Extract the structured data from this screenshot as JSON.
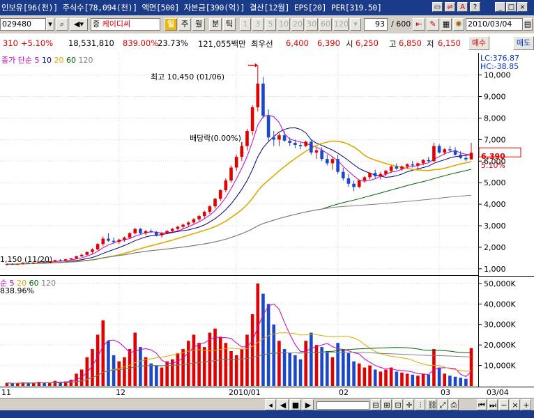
{
  "titlebar": {
    "info": "인보유[96(천)] 주식수[78,094(천)] 액면[500] 자본금[390(억)] 결산[12월] EPS[20] PER[319.50]"
  },
  "toolbar": {
    "code": "029480",
    "market_tag": "증",
    "stock_name": "케이디씨",
    "period_day": "일",
    "period_week": "주",
    "period_month": "월",
    "period_min": "분",
    "period_tick": "틱",
    "intervals": [
      "1",
      "3",
      "5",
      "10",
      "20",
      "30",
      "60",
      "120"
    ],
    "page_value": "93",
    "page_total": "/ 600",
    "date": "2010/03/04"
  },
  "quote": {
    "change": "310",
    "rate": "+5.10%",
    "volume": "18,531,810",
    "vol_rate": "839.00%",
    "turnover": "23.73%",
    "amount": "121,055백만",
    "best_label": "최우선",
    "best_ask": "6,400",
    "best_bid": "6,390",
    "open_label": "시",
    "open": "6,250",
    "high_label": "고",
    "high": "6,850",
    "low_label": "저",
    "low": "6,150",
    "buy_label": "매수",
    "sell_label": "매도"
  },
  "price_pane": {
    "legend_title": "종가 단순",
    "ma_periods": [
      "5",
      "10",
      "20",
      "60",
      "120"
    ],
    "ma_colors": [
      "#cc00cc",
      "#000080",
      "#e0a800",
      "#006600",
      "#808080"
    ],
    "max_annotation": "최고 10,450 (01/06)",
    "dividend_annotation": "배당락(0.00%)",
    "min_annotation": "1,150 (11/20)",
    "lc": "LC:376.87",
    "hc": "HC:-38.85",
    "current_price": "6,390",
    "current_rate": "5.10%"
  },
  "vol_pane": {
    "legend_title": "순",
    "ma_periods": [
      "5",
      "20",
      "60",
      "120"
    ],
    "ratio": "838.96%"
  },
  "price_axis": [
    "10,000",
    "9,000",
    "8,000",
    "7,000",
    "6,000",
    "5,000",
    "4,000",
    "3,000",
    "2,000",
    "1,000"
  ],
  "vol_axis": [
    "50,000K",
    "40,000K",
    "30,000K",
    "20,000K",
    "10,000K"
  ],
  "x_axis": [
    "11",
    "12",
    "2010/01",
    "02",
    "03",
    "03/04"
  ],
  "colors": {
    "up": "#e00000",
    "down": "#1a48c8",
    "titlebar": "#1a3a8a"
  },
  "chart_data": {
    "type": "candlestick",
    "ylim": [
      800,
      10700
    ],
    "vol_ylim": [
      0,
      52000
    ],
    "candles": [
      [
        1200,
        1250,
        1150,
        1220,
        1500
      ],
      [
        1220,
        1260,
        1180,
        1200,
        1200
      ],
      [
        1200,
        1240,
        1170,
        1230,
        1400
      ],
      [
        1230,
        1300,
        1200,
        1280,
        1800
      ],
      [
        1280,
        1320,
        1240,
        1260,
        1500
      ],
      [
        1260,
        1300,
        1220,
        1290,
        1300
      ],
      [
        1290,
        1350,
        1260,
        1330,
        2000
      ],
      [
        1330,
        1380,
        1280,
        1300,
        1600
      ],
      [
        1300,
        1360,
        1270,
        1350,
        1700
      ],
      [
        1350,
        1420,
        1320,
        1400,
        2500
      ],
      [
        1400,
        1450,
        1350,
        1380,
        1800
      ],
      [
        1380,
        1460,
        1360,
        1440,
        2200
      ],
      [
        1440,
        1500,
        1400,
        1480,
        3000
      ],
      [
        1480,
        1600,
        1450,
        1580,
        6000
      ],
      [
        1580,
        1700,
        1550,
        1650,
        8000
      ],
      [
        1650,
        1800,
        1600,
        1780,
        14000
      ],
      [
        1780,
        1950,
        1700,
        1900,
        18000
      ],
      [
        1900,
        2200,
        1850,
        2150,
        25000
      ],
      [
        2150,
        2500,
        2050,
        2400,
        32000
      ],
      [
        2400,
        2650,
        2250,
        2300,
        22000
      ],
      [
        2300,
        2450,
        2150,
        2250,
        15000
      ],
      [
        2250,
        2400,
        2150,
        2350,
        12000
      ],
      [
        2350,
        2500,
        2250,
        2450,
        14000
      ],
      [
        2450,
        2700,
        2400,
        2650,
        18000
      ],
      [
        2650,
        2900,
        2600,
        2850,
        26000
      ],
      [
        2850,
        2900,
        2600,
        2650,
        19000
      ],
      [
        2650,
        2800,
        2550,
        2750,
        14000
      ],
      [
        2750,
        2850,
        2650,
        2700,
        11000
      ],
      [
        2700,
        2750,
        2500,
        2550,
        10000
      ],
      [
        2550,
        2700,
        2450,
        2650,
        9000
      ],
      [
        2650,
        2800,
        2600,
        2750,
        12000
      ],
      [
        2750,
        2900,
        2650,
        2850,
        13000
      ],
      [
        2850,
        3000,
        2750,
        2950,
        16000
      ],
      [
        2950,
        3100,
        2850,
        3050,
        18000
      ],
      [
        3050,
        3200,
        2950,
        3150,
        22000
      ],
      [
        3150,
        3350,
        3050,
        3300,
        25000
      ],
      [
        3300,
        3500,
        3200,
        3450,
        21000
      ],
      [
        3450,
        3700,
        3350,
        3650,
        19000
      ],
      [
        3650,
        3950,
        3550,
        3900,
        26000
      ],
      [
        3900,
        4300,
        3800,
        4250,
        28000
      ],
      [
        4250,
        4700,
        4150,
        4650,
        24000
      ],
      [
        4650,
        5200,
        4550,
        5100,
        21000
      ],
      [
        5100,
        5800,
        5000,
        5700,
        17000
      ],
      [
        5700,
        6300,
        5550,
        6200,
        15000
      ],
      [
        6200,
        6800,
        6000,
        6700,
        18000
      ],
      [
        6700,
        7500,
        6500,
        7400,
        25000
      ],
      [
        7400,
        8600,
        7200,
        8500,
        35000
      ],
      [
        8500,
        10450,
        8300,
        9600,
        50000
      ],
      [
        9600,
        9900,
        8000,
        8100,
        45000
      ],
      [
        8100,
        8400,
        6900,
        7100,
        40000
      ],
      [
        7100,
        7400,
        6700,
        7000,
        30000
      ],
      [
        7000,
        7300,
        6700,
        7200,
        22000
      ],
      [
        7200,
        7400,
        6900,
        6950,
        18000
      ],
      [
        6950,
        7100,
        6700,
        6850,
        16000
      ],
      [
        6850,
        7000,
        6600,
        6750,
        15000
      ],
      [
        6750,
        6900,
        6550,
        6700,
        13000
      ],
      [
        6700,
        6950,
        6650,
        6900,
        22000
      ],
      [
        6900,
        7000,
        6300,
        6400,
        26000
      ],
      [
        6400,
        6600,
        6100,
        6500,
        20000
      ],
      [
        6500,
        6650,
        6000,
        6100,
        19000
      ],
      [
        6100,
        6300,
        5800,
        5900,
        17000
      ],
      [
        5900,
        6200,
        5600,
        6100,
        14000
      ],
      [
        6100,
        6300,
        5400,
        5500,
        21000
      ],
      [
        5500,
        5700,
        5100,
        5200,
        18000
      ],
      [
        5200,
        5400,
        4800,
        4950,
        16000
      ],
      [
        4950,
        5100,
        4600,
        4800,
        12000
      ],
      [
        4800,
        5150,
        4750,
        5100,
        11000
      ],
      [
        5100,
        5300,
        5000,
        5250,
        9000
      ],
      [
        5250,
        5500,
        5150,
        5450,
        10000
      ],
      [
        5450,
        5600,
        5200,
        5300,
        8000
      ],
      [
        5300,
        5500,
        5150,
        5400,
        7000
      ],
      [
        5400,
        5600,
        5300,
        5550,
        8000
      ],
      [
        5550,
        5800,
        5450,
        5750,
        9000
      ],
      [
        5750,
        5900,
        5600,
        5650,
        7000
      ],
      [
        5650,
        5800,
        5550,
        5750,
        6500
      ],
      [
        5750,
        5900,
        5650,
        5850,
        6000
      ],
      [
        5850,
        6000,
        5700,
        5800,
        5500
      ],
      [
        5800,
        5950,
        5650,
        5900,
        5000
      ],
      [
        5900,
        6100,
        5800,
        6050,
        6000
      ],
      [
        6050,
        6200,
        5950,
        6000,
        5500
      ],
      [
        6000,
        6850,
        5950,
        6700,
        18000
      ],
      [
        6700,
        6800,
        6350,
        6400,
        9000
      ],
      [
        6400,
        6600,
        6300,
        6550,
        6000
      ],
      [
        6550,
        6700,
        6400,
        6500,
        5000
      ],
      [
        6500,
        6650,
        6250,
        6300,
        4500
      ],
      [
        6300,
        6450,
        6100,
        6150,
        4000
      ],
      [
        6150,
        6300,
        6000,
        6080,
        3500
      ],
      [
        6080,
        6850,
        6150,
        6390,
        18500
      ]
    ]
  }
}
